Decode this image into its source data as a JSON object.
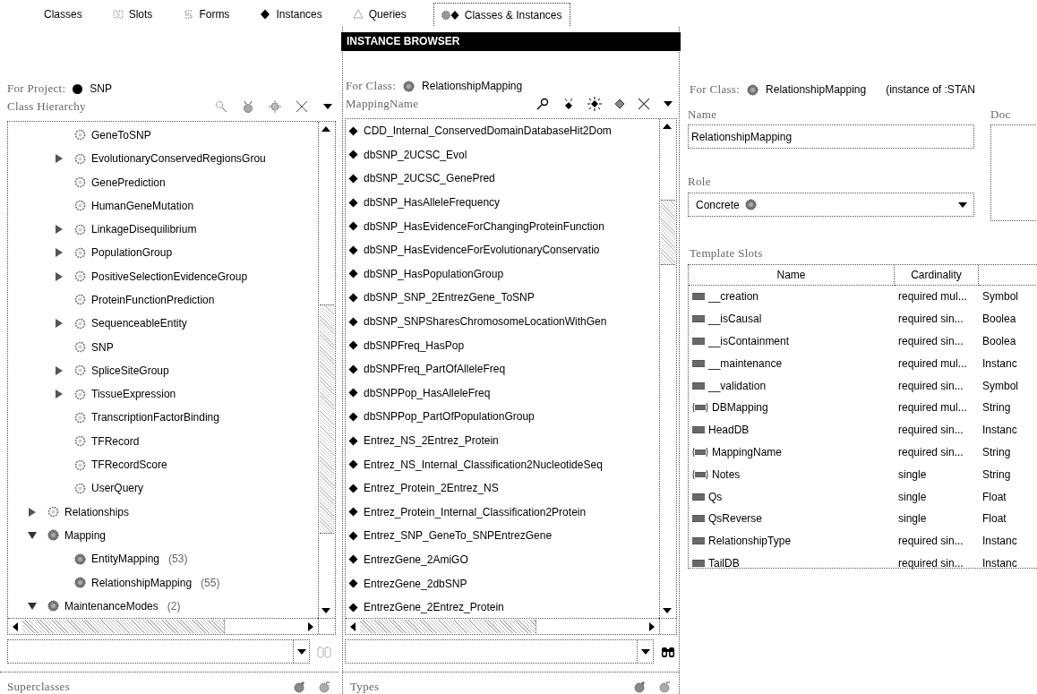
{
  "tabs": [
    {
      "label": "Classes",
      "kind": "plain",
      "selected": false
    },
    {
      "label": "Slots",
      "kind": "slot",
      "selected": false
    },
    {
      "label": "Forms",
      "kind": "form",
      "selected": false
    },
    {
      "label": "Instances",
      "kind": "instance",
      "selected": false
    },
    {
      "label": "Queries",
      "kind": "query",
      "selected": false
    },
    {
      "label": "Classes & Instances",
      "kind": "class-instance",
      "selected": true
    }
  ],
  "class_pane": {
    "project_label": "For Project:",
    "project": "SNP",
    "hierarchy_title": "Class Hierarchy",
    "tree": {
      "children_of_scrolled_parent": [
        {
          "label": "GeneToSNP",
          "concrete": false
        },
        {
          "label": "EvolutionaryConservedRegionsGrou",
          "concrete": false,
          "expanded": false
        },
        {
          "label": "GenePrediction",
          "concrete": false
        },
        {
          "label": "HumanGeneMutation",
          "concrete": false
        },
        {
          "label": "LinkageDisequilibrium",
          "concrete": false,
          "expanded": false
        },
        {
          "label": "PopulationGroup",
          "concrete": false,
          "expanded": false
        },
        {
          "label": "PositiveSelectionEvidenceGroup",
          "concrete": false,
          "expanded": false
        },
        {
          "label": "ProteinFunctionPrediction",
          "concrete": false
        },
        {
          "label": "SequenceableEntity",
          "concrete": false,
          "expanded": false
        },
        {
          "label": "SNP",
          "concrete": false
        },
        {
          "label": "SpliceSiteGroup",
          "concrete": false,
          "expanded": false
        },
        {
          "label": "TissueExpression",
          "concrete": false,
          "expanded": false
        },
        {
          "label": "TranscriptionFactorBinding",
          "concrete": false
        },
        {
          "label": "TFRecord",
          "concrete": false
        },
        {
          "label": "TFRecordScore",
          "concrete": false
        },
        {
          "label": "UserQuery",
          "concrete": false
        }
      ],
      "items": [
        {
          "label": "Relationships",
          "concrete": false,
          "expanded": false
        },
        {
          "label": "Mapping",
          "concrete": true,
          "expanded": true,
          "children": [
            {
              "label": "EntityMapping",
              "count": "(53)",
              "concrete": true
            },
            {
              "label": "RelationshipMapping",
              "count": "(55)",
              "concrete": true
            }
          ]
        },
        {
          "label": "MaintenanceModes",
          "count": "(2)",
          "concrete": true,
          "expanded": true
        }
      ]
    },
    "superclasses_title": "Superclasses"
  },
  "instance_browser": {
    "title": "INSTANCE BROWSER",
    "class_label": "For Class:",
    "class_name": "RelationshipMapping",
    "list_title": "MappingName",
    "instances": [
      "CDD_Internal_ConservedDomainDatabaseHit2Dom",
      "dbSNP_2UCSC_Evol",
      "dbSNP_2UCSC_GenePred",
      "dbSNP_HasAlleleFrequency",
      "dbSNP_HasEvidenceForChangingProteinFunction",
      "dbSNP_HasEvidenceForEvolutionaryConservatio",
      "dbSNP_HasPopulationGroup",
      "dbSNP_SNP_2EntrezGene_ToSNP",
      "dbSNP_SNPSharesChromosomeLocationWithGen",
      "dbSNPFreq_HasPop",
      "dbSNPFreq_PartOfAlleleFreq",
      "dbSNPPop_HasAlleleFreq",
      "dbSNPPop_PartOfPopulationGroup",
      "Entrez_NS_2Entrez_Protein",
      "Entrez_NS_Internal_Classification2NucleotideSeq",
      "Entrez_Protein_2Entrez_NS",
      "Entrez_Protein_Internal_Classification2Protein",
      "Entrez_SNP_GeneTo_SNPEntrezGene",
      "EntrezGene_2AmiGO",
      "EntrezGene_2dbSNP",
      "EntrezGene_2Entrez_Protein"
    ],
    "types_title": "Types"
  },
  "class_form": {
    "class_label": "For Class:",
    "class_name": "RelationshipMapping",
    "instance_of": "(instance of :STAN",
    "name_label": "Name",
    "name_value": "RelationshipMapping",
    "role_label": "Role",
    "role_value": "Concrete",
    "documentation_label": "Doc",
    "template_slots_title": "Template Slots",
    "columns": [
      "Name",
      "Cardinality"
    ],
    "slots": [
      {
        "kind": "plain",
        "name": "__creation",
        "cardinality": "required mul...",
        "column_3": "Symbol"
      },
      {
        "kind": "plain",
        "name": "__isCausal",
        "cardinality": "required sin...",
        "column_3": "Boolea"
      },
      {
        "kind": "plain",
        "name": "__isContainment",
        "cardinality": "required sin...",
        "column_3": "Boolea"
      },
      {
        "kind": "plain",
        "name": "__maintenance",
        "cardinality": "required mul...",
        "column_3": "Instanc"
      },
      {
        "kind": "plain",
        "name": "__validation",
        "cardinality": "required sin...",
        "column_3": "Symbol"
      },
      {
        "kind": "bracketed",
        "name": "DBMapping",
        "cardinality": "required mul...",
        "column_3": "String"
      },
      {
        "kind": "plain",
        "name": "HeadDB",
        "cardinality": "required sin...",
        "column_3": "Instanc"
      },
      {
        "kind": "bracketed",
        "name": "MappingName",
        "cardinality": "required sin...",
        "column_3": "String"
      },
      {
        "kind": "bracketed",
        "name": "Notes",
        "cardinality": "single",
        "column_3": "String"
      },
      {
        "kind": "plain",
        "name": "Qs",
        "cardinality": "single",
        "column_3": "Float"
      },
      {
        "kind": "plain",
        "name": "QsReverse",
        "cardinality": "single",
        "column_3": "Float"
      },
      {
        "kind": "plain",
        "name": "RelationshipType",
        "cardinality": "required sin...",
        "column_3": "Instanc"
      },
      {
        "kind": "plain",
        "name": "TailDB",
        "cardinality": "required sin...",
        "column_3": "Instanc"
      }
    ]
  }
}
